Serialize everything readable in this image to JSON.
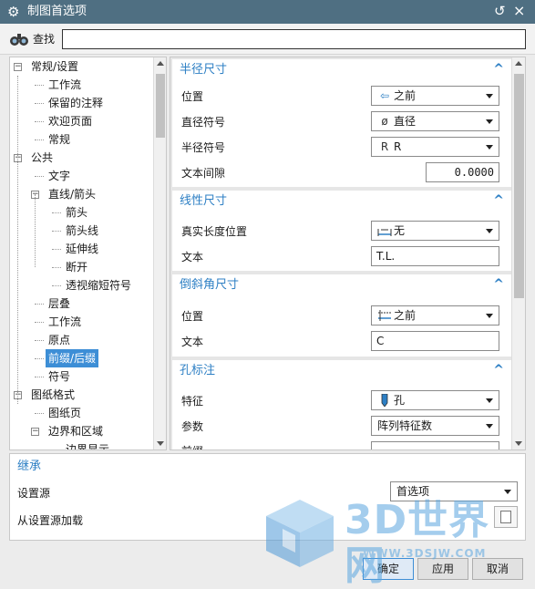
{
  "window": {
    "title": "制图首选项"
  },
  "find": {
    "label": "查找",
    "value": ""
  },
  "tree": {
    "items": [
      {
        "label": "常规/设置",
        "level": 0,
        "expander": "−"
      },
      {
        "label": "工作流",
        "level": 1
      },
      {
        "label": "保留的注释",
        "level": 1
      },
      {
        "label": "欢迎页面",
        "level": 1
      },
      {
        "label": "常规",
        "level": 1
      },
      {
        "label": "公共",
        "level": 0,
        "expander": "−"
      },
      {
        "label": "文字",
        "level": 1
      },
      {
        "label": "直线/箭头",
        "level": 1,
        "expander": "−"
      },
      {
        "label": "箭头",
        "level": 2
      },
      {
        "label": "箭头线",
        "level": 2
      },
      {
        "label": "延伸线",
        "level": 2
      },
      {
        "label": "断开",
        "level": 2
      },
      {
        "label": "透视缩短符号",
        "level": 2
      },
      {
        "label": "层叠",
        "level": 1
      },
      {
        "label": "工作流",
        "level": 1
      },
      {
        "label": "原点",
        "level": 1
      },
      {
        "label": "前缀/后缀",
        "level": 1,
        "selected": true
      },
      {
        "label": "符号",
        "level": 1
      },
      {
        "label": "图纸格式",
        "level": 0,
        "expander": "−"
      },
      {
        "label": "图纸页",
        "level": 1
      },
      {
        "label": "边界和区域",
        "level": 1,
        "expander": "−"
      },
      {
        "label": "边界显示",
        "level": 2
      }
    ]
  },
  "sections": {
    "radius": {
      "title": "半径尺寸",
      "position_label": "位置",
      "position_value": "之前",
      "diameter_symbol_label": "直径符号",
      "diameter_symbol_icon": "ø",
      "diameter_symbol_value": "直径",
      "radius_symbol_label": "半径符号",
      "radius_symbol_icon": "R",
      "radius_symbol_value": "R",
      "text_gap_label": "文本间隙",
      "text_gap_value": "0.0000"
    },
    "linear": {
      "title": "线性尺寸",
      "true_length_label": "真实长度位置",
      "true_length_value": "无",
      "text_label": "文本",
      "text_value": "T.L."
    },
    "chamfer": {
      "title": "倒斜角尺寸",
      "position_label": "位置",
      "position_value": "之前",
      "text_label": "文本",
      "text_value": "C"
    },
    "hole": {
      "title": "孔标注",
      "feature_label": "特征",
      "feature_value": "孔",
      "param_label": "参数",
      "param_value": "阵列特征数",
      "prefix_label": "前缀"
    }
  },
  "inherit": {
    "title": "继承",
    "source_label": "设置源",
    "source_value": "首选项",
    "load_label": "从设置源加载"
  },
  "buttons": {
    "ok": "确定",
    "apply": "应用",
    "cancel": "取消"
  },
  "watermark": {
    "brand": "3D世界网",
    "url": "WWW.3DSJW.COM"
  },
  "colors": {
    "titlebar": "#4f6f82",
    "accent": "#2d7fc4",
    "selection": "#3d8ed6"
  }
}
